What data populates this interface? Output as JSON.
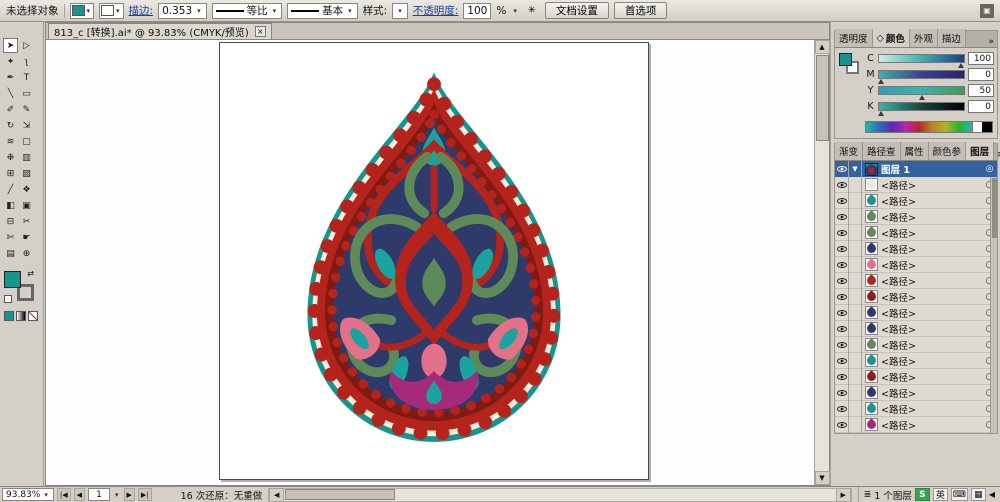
{
  "options_bar": {
    "status": "未选择对象",
    "stroke_label": "描边:",
    "stroke_weight": "0.353",
    "profile_label": "等比",
    "brush_label": "基本",
    "style_label": "样式:",
    "opacity_label": "不透明度:",
    "opacity_value": "100",
    "opacity_unit": "%",
    "doc_setup_button": "文档设置",
    "preferences_button": "首选项"
  },
  "document_tab": {
    "title": "813_c [转换].ai* @ 93.83% (CMYK/预览)",
    "close_glyph": "×"
  },
  "icons": {
    "dropdown": "▾",
    "scroll_up": "▲",
    "scroll_down": "▼",
    "scroll_left": "◀",
    "scroll_right": "▶",
    "nav_first": "|◀",
    "nav_prev": "◀",
    "nav_next": "▶",
    "nav_last": "▶|",
    "overflow": "»",
    "panel_menu": "≡",
    "recolor": "✳",
    "swap": "⇄",
    "collapse": "◀",
    "layers_mini": "≣",
    "panel_toggle": "▣"
  },
  "tools": [
    {
      "name": "selection-tool",
      "glyph": "➤"
    },
    {
      "name": "direct-selection-tool",
      "glyph": "▷"
    },
    {
      "name": "magic-wand-tool",
      "glyph": "✦"
    },
    {
      "name": "lasso-tool",
      "glyph": "ʅ"
    },
    {
      "name": "pen-tool",
      "glyph": "✒"
    },
    {
      "name": "type-tool",
      "glyph": "T"
    },
    {
      "name": "line-segment-tool",
      "glyph": "╲"
    },
    {
      "name": "rectangle-tool",
      "glyph": "▭"
    },
    {
      "name": "paintbrush-tool",
      "glyph": "✐"
    },
    {
      "name": "pencil-tool",
      "glyph": "✎"
    },
    {
      "name": "rotate-tool",
      "glyph": "↻"
    },
    {
      "name": "scale-tool",
      "glyph": "⇲"
    },
    {
      "name": "warp-tool",
      "glyph": "≋"
    },
    {
      "name": "free-transform-tool",
      "glyph": "▢"
    },
    {
      "name": "symbol-sprayer-tool",
      "glyph": "❉"
    },
    {
      "name": "graph-tool",
      "glyph": "▥"
    },
    {
      "name": "mesh-tool",
      "glyph": "⊞"
    },
    {
      "name": "gradient-tool",
      "glyph": "▧"
    },
    {
      "name": "eyedropper-tool",
      "glyph": "╱"
    },
    {
      "name": "blend-tool",
      "glyph": "❖"
    },
    {
      "name": "live-paint-bucket-tool",
      "glyph": "◧"
    },
    {
      "name": "live-paint-selection-tool",
      "glyph": "▣"
    },
    {
      "name": "crop-area-tool",
      "glyph": "⊟"
    },
    {
      "name": "slice-tool",
      "glyph": "✂"
    },
    {
      "name": "scissors-tool",
      "glyph": "✄"
    },
    {
      "name": "hand-tool",
      "glyph": "☛"
    },
    {
      "name": "page-tool",
      "glyph": "▤"
    },
    {
      "name": "zoom-tool",
      "glyph": "⊕"
    }
  ],
  "color_panel": {
    "tabs": [
      "透明度",
      "颜色",
      "外观",
      "描边"
    ],
    "active_tab_icon": "◇",
    "channels": [
      {
        "label": "C",
        "value": "100",
        "pos_css": "97%",
        "grad": "linear-gradient(90deg,#cdeee9,#36b5ae,#173f8f)"
      },
      {
        "label": "M",
        "value": "0",
        "pos_css": "2%",
        "grad": "linear-gradient(90deg,#36b5ae,#3a3f96,#2a2470)"
      },
      {
        "label": "Y",
        "value": "50",
        "pos_css": "50%",
        "grad": "linear-gradient(90deg,#2e9ec0,#36b5ae,#3aa04e)"
      },
      {
        "label": "K",
        "value": "0",
        "pos_css": "2%",
        "grad": "linear-gradient(90deg,#36b5ae,#14453f,#000000)"
      }
    ]
  },
  "layers_panel": {
    "tabs": [
      "渐变",
      "路径查",
      "属性",
      "颜色参",
      "图层"
    ],
    "layer_name": "图层 1",
    "expander_glyph": "▼",
    "head_target_glyph": "◎",
    "row_target_glyph": "○",
    "rows": [
      {
        "label": "<路径>",
        "color": "#ece8da"
      },
      {
        "label": "<路径>",
        "color": "#1b9694"
      },
      {
        "label": "<路径>",
        "color": "#5d8a58"
      },
      {
        "label": "<路径>",
        "color": "#5d8a58"
      },
      {
        "label": "<路径>",
        "color": "#2e3a69"
      },
      {
        "label": "<路径>",
        "color": "#e27189"
      },
      {
        "label": "<路径>",
        "color": "#b5231d"
      },
      {
        "label": "<路径>",
        "color": "#8c2018"
      },
      {
        "label": "<路径>",
        "color": "#2e3a69"
      },
      {
        "label": "<路径>",
        "color": "#2e3a69"
      },
      {
        "label": "<路径>",
        "color": "#5d8a58"
      },
      {
        "label": "<路径>",
        "color": "#1b9694"
      },
      {
        "label": "<路径>",
        "color": "#8c2018"
      },
      {
        "label": "<路径>",
        "color": "#2e3a69"
      },
      {
        "label": "<路径>",
        "color": "#1b9694"
      },
      {
        "label": "<路径>",
        "color": "#a62a7a"
      }
    ]
  },
  "status_bar": {
    "zoom": "93.83%",
    "page": "1",
    "history": "16 次还原：无重做",
    "layers_info": "1 个图层",
    "ime_badge": "S",
    "lang_badge": "英",
    "tray_icon_1": "⌨",
    "tray_icon_2": "▦"
  },
  "ornament": {
    "palette": {
      "teal": "#17948e",
      "teal2": "#1aa3a0",
      "cream": "#f2eedd",
      "red": "#b5231d",
      "maroon": "#801b13",
      "navy": "#2e3a69",
      "green": "#5d8a58",
      "pink": "#e27189",
      "magenta": "#a62a7a"
    }
  }
}
